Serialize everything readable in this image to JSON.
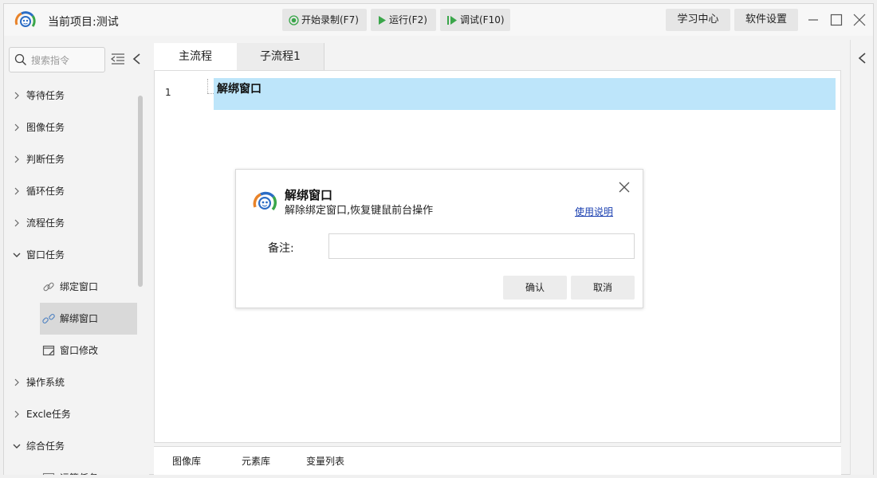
{
  "titlebar": {
    "project_title": "当前项目:测试",
    "record_label": "开始录制(F7)",
    "run_label": "运行(F2)",
    "debug_label": "调试(F10)",
    "learn_label": "学习中心",
    "settings_label": "软件设置",
    "accent_green": "#3aa64a"
  },
  "sidebar": {
    "search_placeholder": "搜索指令",
    "items": [
      {
        "label": "等待任务",
        "expanded": false
      },
      {
        "label": "图像任务",
        "expanded": false
      },
      {
        "label": "判断任务",
        "expanded": false
      },
      {
        "label": "循环任务",
        "expanded": false
      },
      {
        "label": "流程任务",
        "expanded": false
      },
      {
        "label": "窗口任务",
        "expanded": true
      },
      {
        "label": "操作系统",
        "expanded": false
      },
      {
        "label": "Excle任务",
        "expanded": false
      },
      {
        "label": "综合任务",
        "expanded": true
      }
    ],
    "window_children": [
      {
        "label": "绑定窗口",
        "icon": "link-icon"
      },
      {
        "label": "解绑窗口",
        "icon": "unlink-icon",
        "selected": true
      },
      {
        "label": "窗口修改",
        "icon": "window-edit-icon"
      }
    ],
    "misc_children": [
      {
        "label": "运算任务",
        "icon": "calc-icon"
      }
    ]
  },
  "tabs": {
    "main": "主流程",
    "sub": "子流程1"
  },
  "editor": {
    "line_number": "1",
    "command": "解绑窗口",
    "highlight_color": "#bde5fa"
  },
  "bottom_tabs": {
    "images": "图像库",
    "elements": "元素库",
    "variables": "变量列表"
  },
  "dialog": {
    "title": "解绑窗口",
    "description": "解除绑定窗口,恢复键鼠前台操作",
    "help_link": "使用说明",
    "note_label": "备注:",
    "note_value": "",
    "ok_label": "确认",
    "cancel_label": "取消"
  }
}
